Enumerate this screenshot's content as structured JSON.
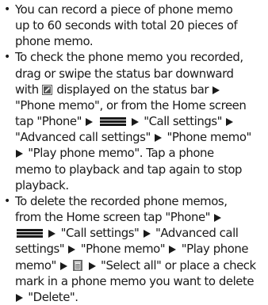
{
  "bullets": [
    {
      "lines": [
        [
          "You can record a piece of phone memo"
        ],
        [
          "up to 60 seconds with total 20 pieces of"
        ],
        [
          "phone memo."
        ]
      ]
    },
    {
      "lines": [
        [
          "To check the phone memo you recorded,"
        ],
        [
          "drag or swipe the status bar downward"
        ],
        [
          "with ",
          "{memo-icon}",
          " displayed on the status bar ",
          "{arrow}"
        ],
        [
          "\"Phone memo\", or from the Home screen"
        ],
        [
          "tap \"Phone\" ",
          "{arrow}",
          " ",
          "{menu-icon}",
          " ",
          "{arrow}",
          " \"Call settings\" ",
          "{arrow}"
        ],
        [
          "\"Advanced call settings\" ",
          "{arrow}",
          " \"Phone memo\""
        ],
        [
          "{arrow}",
          " \"Play phone memo\". Tap a phone"
        ],
        [
          "memo to playback and tap again to stop"
        ],
        [
          "playback."
        ]
      ]
    },
    {
      "lines": [
        [
          "To delete the recorded phone memos,"
        ],
        [
          "from the Home screen tap \"Phone\" ",
          "{arrow}"
        ],
        [
          "{menu-icon}",
          " ",
          "{arrow}",
          " \"Call settings\" ",
          "{arrow}",
          " \"Advanced call"
        ],
        [
          "settings\" ",
          "{arrow}",
          " \"Phone memo\" ",
          "{arrow}",
          " \"Play phone"
        ],
        [
          "memo\" ",
          "{arrow}",
          " ",
          "{trash-icon}",
          " ",
          "{arrow}",
          " \"Select all\" or place a check"
        ],
        [
          "mark in a phone memo you want to delete"
        ],
        [
          "{arrow}",
          " \"Delete\"."
        ]
      ]
    }
  ]
}
